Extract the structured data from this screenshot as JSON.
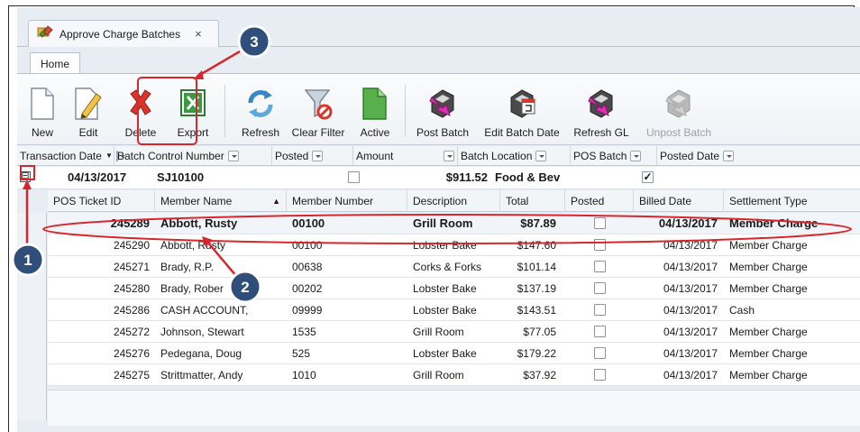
{
  "window": {
    "doc_tab": {
      "title": "Approve Charge Batches",
      "close": "×"
    },
    "ribbon_tab": "Home"
  },
  "ribbon": {
    "buttons": [
      {
        "label": "New",
        "icon": "new-document-icon"
      },
      {
        "label": "Edit",
        "icon": "edit-pencil-icon"
      },
      {
        "label": "Delete",
        "icon": "delete-x-icon"
      },
      {
        "label": "Export",
        "icon": "excel-export-icon"
      },
      {
        "label": "Refresh",
        "icon": "refresh-icon"
      },
      {
        "label": "Clear Filter",
        "icon": "clear-filter-icon"
      },
      {
        "label": "Active",
        "icon": "active-document-icon"
      },
      {
        "label": "Post Batch",
        "icon": "post-batch-icon"
      },
      {
        "label": "Edit Batch Date",
        "icon": "edit-batch-date-icon"
      },
      {
        "label": "Refresh GL",
        "icon": "refresh-gl-icon"
      },
      {
        "label": "Unpost Batch",
        "icon": "unpost-batch-icon",
        "disabled": true
      }
    ]
  },
  "filter_columns": [
    {
      "label": "Transaction Date",
      "sort": "▼"
    },
    {
      "label": "Batch Control Number"
    },
    {
      "label": "Posted"
    },
    {
      "label": "Amount"
    },
    {
      "label": "Batch Location"
    },
    {
      "label": "POS Batch"
    },
    {
      "label": "Posted Date"
    }
  ],
  "group": {
    "expander": "⊟",
    "date": "04/13/2017",
    "batch": "SJ10100",
    "posted": false,
    "amount": "$911.52",
    "location": "Food & Bev",
    "pos_batch": true,
    "pos_batch_mark": "✓"
  },
  "grid": {
    "columns": [
      "POS Ticket ID",
      "Member Name",
      "Member Number",
      "Description",
      "Total",
      "Posted",
      "Billed Date",
      "Settlement Type"
    ],
    "sort_indicator": "▲",
    "rows": [
      {
        "id": "245289",
        "name": "Abbott, Rusty",
        "number": "00100",
        "desc": "Grill Room",
        "total": "$87.89",
        "posted": false,
        "billed": "04/13/2017",
        "type": "Member Charge"
      },
      {
        "id": "245290",
        "name": "Abbott, Rusty",
        "number": "00100",
        "desc": "Lobster Bake",
        "total": "$147.60",
        "posted": false,
        "billed": "04/13/2017",
        "type": "Member Charge"
      },
      {
        "id": "245271",
        "name": "Brady, R.P.",
        "number": "00638",
        "desc": "Corks & Forks",
        "total": "$101.14",
        "posted": false,
        "billed": "04/13/2017",
        "type": "Member Charge"
      },
      {
        "id": "245280",
        "name": "Brady, Rober",
        "number": "00202",
        "desc": "Lobster Bake",
        "total": "$137.19",
        "posted": false,
        "billed": "04/13/2017",
        "type": "Member Charge"
      },
      {
        "id": "245286",
        "name": "CASH ACCOUNT,",
        "number": "09999",
        "desc": "Lobster Bake",
        "total": "$143.51",
        "posted": false,
        "billed": "04/13/2017",
        "type": "Cash"
      },
      {
        "id": "245272",
        "name": "Johnson, Stewart",
        "number": "1535",
        "desc": "Grill Room",
        "total": "$77.05",
        "posted": false,
        "billed": "04/13/2017",
        "type": "Member Charge"
      },
      {
        "id": "245276",
        "name": "Pedegana, Doug",
        "number": "525",
        "desc": "Lobster Bake",
        "total": "$179.22",
        "posted": false,
        "billed": "04/13/2017",
        "type": "Member Charge"
      },
      {
        "id": "245275",
        "name": "Strittmatter, Andy",
        "number": "1010",
        "desc": "Grill Room",
        "total": "$37.92",
        "posted": false,
        "billed": "04/13/2017",
        "type": "Member Charge"
      }
    ]
  },
  "callouts": [
    {
      "number": "1"
    },
    {
      "number": "2"
    },
    {
      "number": "3"
    }
  ],
  "colors": {
    "callout_badge": "#2f4f7a",
    "callout_ring": "#ffffff",
    "callout_line": "#d9262c"
  }
}
